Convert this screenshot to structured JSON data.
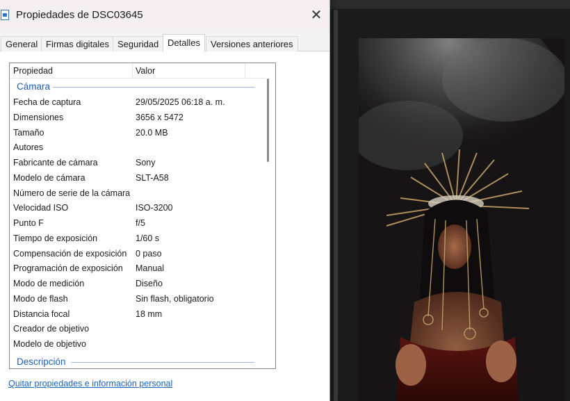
{
  "window": {
    "title": "Propiedades de DSC03645",
    "close_glyph": "✕"
  },
  "tabs": [
    {
      "label": "General"
    },
    {
      "label": "Firmas digitales"
    },
    {
      "label": "Seguridad"
    },
    {
      "label": "Detalles",
      "active": true
    },
    {
      "label": "Versiones anteriores"
    }
  ],
  "list": {
    "columns": {
      "property": "Propiedad",
      "value": "Valor"
    },
    "groups": {
      "camera": "Cámara",
      "description": "Descripción"
    },
    "rows": [
      {
        "property": "Fecha de captura",
        "value": "29/05/2025 06:18 a. m."
      },
      {
        "property": "Dimensiones",
        "value": "3656 x 5472"
      },
      {
        "property": "Tamaño",
        "value": "20.0 MB"
      },
      {
        "property": "Autores",
        "value": ""
      },
      {
        "property": "Fabricante de cámara",
        "value": "Sony"
      },
      {
        "property": "Modelo de cámara",
        "value": "SLT-A58"
      },
      {
        "property": "Número de serie de la cámara",
        "value": ""
      },
      {
        "property": "Velocidad ISO",
        "value": "ISO-3200"
      },
      {
        "property": "Punto F",
        "value": "f/5"
      },
      {
        "property": "Tiempo de exposición",
        "value": "1/60 s"
      },
      {
        "property": "Compensación de exposición",
        "value": "0 paso"
      },
      {
        "property": "Programación de exposición",
        "value": "Manual"
      },
      {
        "property": "Modo de medición",
        "value": "Diseño"
      },
      {
        "property": "Modo de flash",
        "value": "Sin flash, obligatorio"
      },
      {
        "property": "Distancia focal",
        "value": "18 mm"
      },
      {
        "property": "Creador de objetivo",
        "value": ""
      },
      {
        "property": "Modelo de objetivo",
        "value": ""
      }
    ]
  },
  "footer": {
    "remove_link": "Quitar propiedades e información personal"
  },
  "icons": {
    "file": "image-file-icon",
    "close": "close-icon"
  },
  "colors": {
    "group_heading": "#1e5fb4",
    "link": "#1565c0",
    "dialog_bg": "#ffffff",
    "viewer_bg": "#1b1b1b"
  }
}
